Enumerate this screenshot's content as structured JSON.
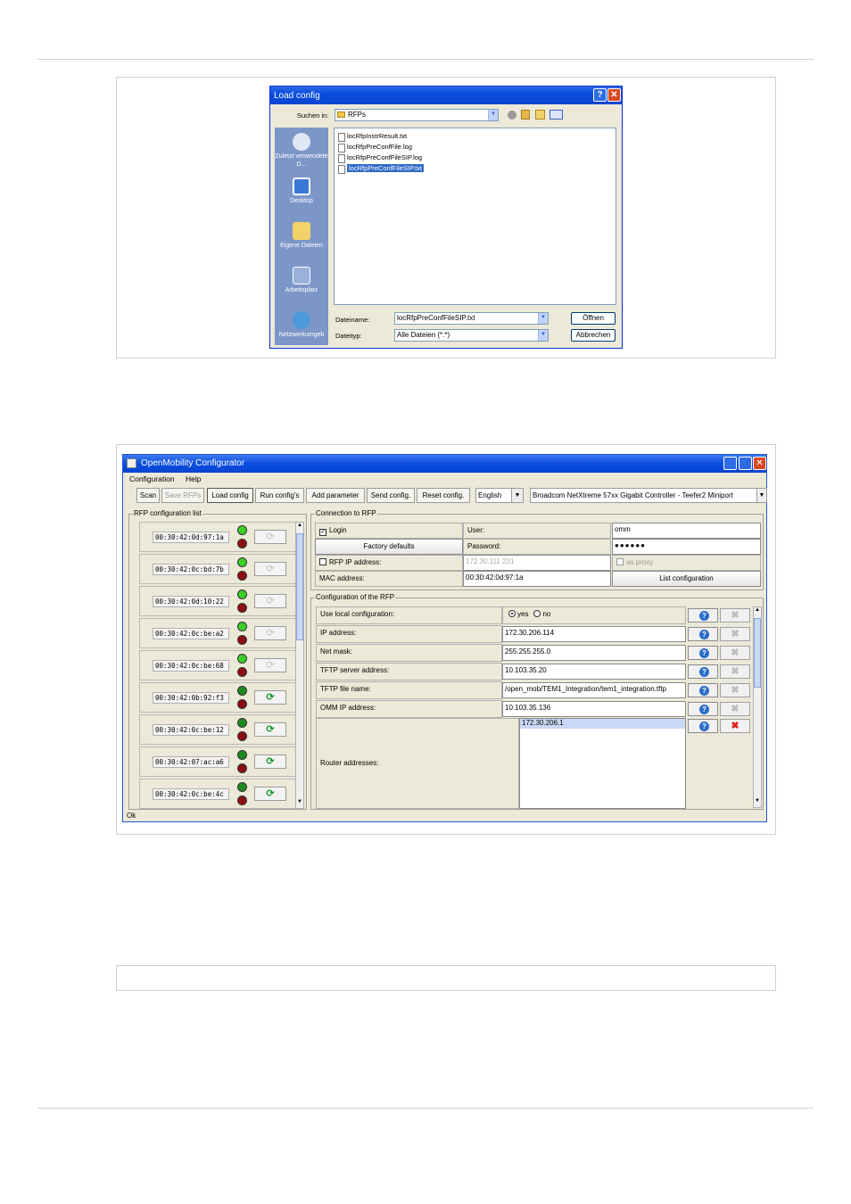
{
  "load_dialog": {
    "title": "Load config",
    "help_glyph": "?",
    "close_glyph": "✕",
    "look_in_label": "Suchen in:",
    "look_in_value": "RFPs",
    "places": [
      {
        "label": "Zuletzt verwendete D...",
        "icon": "recent-icon"
      },
      {
        "label": "Desktop",
        "icon": "desktop-icon"
      },
      {
        "label": "Eigene Dateien",
        "icon": "my-files-icon"
      },
      {
        "label": "Arbeitsplatz",
        "icon": "my-computer-icon"
      },
      {
        "label": "Netzwerkumgeb",
        "icon": "network-icon"
      }
    ],
    "files": [
      "locRfpInstrResult.txt",
      "locRfpPreConfFile.log",
      "locRfpPreConfFileSIP.log",
      "locRfpPreConfFileSIP.txt"
    ],
    "selected_file_index": 3,
    "filename_label": "Dateiname:",
    "filename_value": "locRfpPreConfFileSIP.txt",
    "filetype_label": "Dateityp:",
    "filetype_value": "Alle Dateien (*.*)",
    "open_label": "Öffnen",
    "cancel_label": "Abbrechen"
  },
  "configurator": {
    "title": "OpenMobility Configurator",
    "menu": [
      "Configuration",
      "Help"
    ],
    "toolbar": [
      "Scan",
      "Save RFPs",
      "Load config",
      "Run config's",
      "Add parameter",
      "Send config.",
      "Reset config."
    ],
    "language": "English",
    "adapter": "Broadcom NetXtreme 57xx Gigabit Controller - Teefer2 Miniport",
    "rfp_list_title": "RFP configuration list",
    "rfps": [
      {
        "mac": "00:30:42:0d:97:1a",
        "sync_enabled": false
      },
      {
        "mac": "00:30:42:0c:bd:7b",
        "sync_enabled": false
      },
      {
        "mac": "00:30:42:0d:10:22",
        "sync_enabled": false
      },
      {
        "mac": "00:30:42:0c:be:a2",
        "sync_enabled": false
      },
      {
        "mac": "00:30:42:0c:be:68",
        "sync_enabled": false
      },
      {
        "mac": "00:30:42:0b:92:f3",
        "sync_enabled": true
      },
      {
        "mac": "00:30:42:0c:be:12",
        "sync_enabled": true
      },
      {
        "mac": "00:30:42:07:ac:a6",
        "sync_enabled": true
      },
      {
        "mac": "00:30:42:0c:be:4c",
        "sync_enabled": true
      }
    ],
    "connection": {
      "title": "Connection to RFP",
      "login_label": "Login",
      "user_label": "User:",
      "user_value": "omm",
      "factory_defaults_label": "Factory defaults",
      "password_label": "Password:",
      "password_value": "●●●●●●",
      "rfp_ip_label": "RFP IP address:",
      "rfp_ip_value": "172.30.111.231",
      "as_proxy_label": "as proxy",
      "mac_label": "MAC address:",
      "mac_value": "00:30:42:0d:97:1a",
      "list_config_label": "List configuration"
    },
    "rfp_config": {
      "title": "Configuration of the RFP",
      "use_local_label": "Use local configuration:",
      "yes_label": "yes",
      "no_label": "no",
      "rows": [
        {
          "label": "IP address:",
          "value": "172.30.206.114"
        },
        {
          "label": "Net mask:",
          "value": "255.255.255.0"
        },
        {
          "label": "TFTP server address:",
          "value": "10.103.35.20"
        },
        {
          "label": "TFTP file name:",
          "value": "/open_mob/TEM1_Integration/tem1_integration.tftp"
        },
        {
          "label": "OMM IP address:",
          "value": "10.103.35.136"
        }
      ],
      "router_label": "Router addresses:",
      "router_values": [
        "172.30.206.1"
      ]
    },
    "help_glyph": "?",
    "delete_glyph": "✖",
    "sync_glyph": "⟳",
    "status": "Ok"
  }
}
